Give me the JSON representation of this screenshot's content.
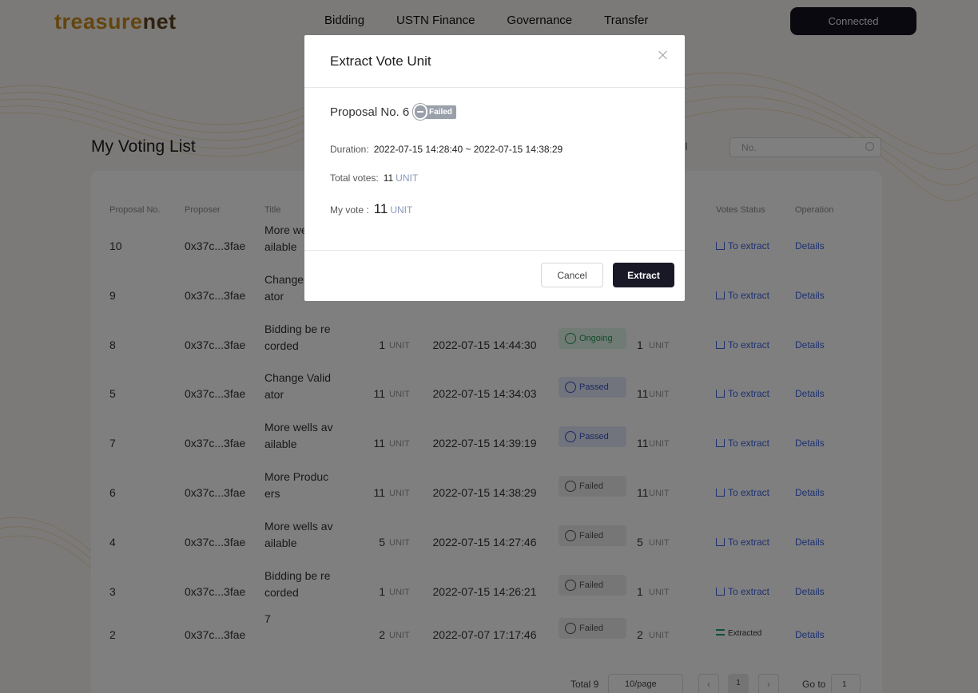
{
  "header": {
    "logo_a": "treasure",
    "logo_b": "net",
    "nav": [
      "Bidding",
      "USTN Finance",
      "Governance",
      "Transfer"
    ],
    "connect_label": "Connected"
  },
  "page": {
    "title": "My Voting List",
    "filter": "All",
    "search_placeholder": "No."
  },
  "table": {
    "headers": [
      "Proposal No.",
      "Proposer",
      "Title",
      "Votes Status",
      "Operation"
    ],
    "rows": [
      {
        "no": "10",
        "proposer": "0x37c...3fae",
        "title": "More wells av ailable",
        "total": "",
        "date": "",
        "status": "",
        "my": "",
        "votes_status": "To extract",
        "op": "Details"
      },
      {
        "no": "9",
        "proposer": "0x37c...3fae",
        "title": "Change Valid ator",
        "total": "",
        "date": "",
        "status": "",
        "my": "",
        "votes_status": "To extract",
        "op": "Details"
      },
      {
        "no": "8",
        "proposer": "0x37c...3fae",
        "title": "Bidding be re corded",
        "total": "1",
        "date": "2022-07-15 14:44:30",
        "status": "Ongoing",
        "my": "1",
        "votes_status": "To extract",
        "op": "Details"
      },
      {
        "no": "5",
        "proposer": "0x37c...3fae",
        "title": "Change Valid ator",
        "total": "11",
        "date": "2022-07-15 14:34:03",
        "status": "Passed",
        "my": "11",
        "votes_status": "To extract",
        "op": "Details"
      },
      {
        "no": "7",
        "proposer": "0x37c...3fae",
        "title": "More wells av ailable",
        "total": "11",
        "date": "2022-07-15 14:39:19",
        "status": "Passed",
        "my": "11",
        "votes_status": "To extract",
        "op": "Details"
      },
      {
        "no": "6",
        "proposer": "0x37c...3fae",
        "title": "More Produc ers",
        "total": "11",
        "date": "2022-07-15 14:38:29",
        "status": "Failed",
        "my": "11",
        "votes_status": "To extract",
        "op": "Details"
      },
      {
        "no": "4",
        "proposer": "0x37c...3fae",
        "title": "More wells av ailable",
        "total": "5",
        "date": "2022-07-15 14:27:46",
        "status": "Failed",
        "my": "5",
        "votes_status": "To extract",
        "op": "Details"
      },
      {
        "no": "3",
        "proposer": "0x37c...3fae",
        "title": "Bidding be re corded",
        "total": "1",
        "date": "2022-07-15 14:26:21",
        "status": "Failed",
        "my": "1",
        "votes_status": "To extract",
        "op": "Details"
      },
      {
        "no": "2",
        "proposer": "0x37c...3fae",
        "title": "7",
        "total": "2",
        "date": "2022-07-07 17:17:46",
        "status": "Failed",
        "my": "2",
        "votes_status": "Extracted",
        "op": "Details"
      }
    ],
    "unit": "UNIT"
  },
  "pager": {
    "total": "Total 9",
    "page_size": "10/page",
    "current": "1",
    "goto_label": "Go to",
    "goto_value": "1"
  },
  "modal": {
    "title": "Extract Vote Unit",
    "proposal_label": "Proposal No. 6",
    "badge": "Failed",
    "duration_label": "Duration:",
    "duration_value": "2022-07-15 14:28:40 ~ 2022-07-15 14:38:29",
    "total_label": "Total votes:",
    "total_value": "11",
    "my_label": "My vote :",
    "my_value": "11",
    "unit": "UNIT",
    "cancel_label": "Cancel",
    "extract_label": "Extract"
  }
}
